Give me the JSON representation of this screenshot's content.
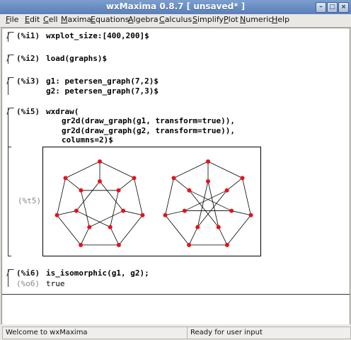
{
  "window": {
    "title": "wxMaxima 0.8.7 [ unsaved* ]"
  },
  "window_buttons": [
    {
      "name": "minimize-icon",
      "glyph": "–"
    },
    {
      "name": "maximize-icon",
      "glyph": "□"
    },
    {
      "name": "close-icon",
      "glyph": "×"
    }
  ],
  "menu": [
    "File",
    "Edit",
    "Cell",
    "Maxima",
    "Equations",
    "Algebra",
    "Calculus",
    "Simplify",
    "Plot",
    "Numeric",
    "Help"
  ],
  "cells": {
    "i1": {
      "label": "(%i1)",
      "code": "wxplot_size:[400,200]$"
    },
    "i2": {
      "label": "(%i2)",
      "code": "load(graphs)$"
    },
    "i3": {
      "label": "(%i3)",
      "line1": "g1: petersen_graph(7,2)$",
      "line2": "g2: petersen_graph(7,3)$"
    },
    "i5": {
      "label": "(%i5)",
      "line1": "wxdraw(",
      "line2": "gr2d(draw_graph(g1, transform=true)),",
      "line3": "gr2d(draw_graph(g2, transform=true)),",
      "line4": "columns=2)$"
    },
    "t5": {
      "label": "(%t5)"
    },
    "i6": {
      "label": "(%i6)",
      "code": "is_isomorphic(g1, g2);"
    },
    "o6": {
      "label": "(%o6)",
      "value": "true"
    }
  },
  "graphs": [
    {
      "name": "petersen-7-2",
      "n": 7,
      "k": 2
    },
    {
      "name": "petersen-7-3",
      "n": 7,
      "k": 3
    }
  ],
  "colors": {
    "vertex": "#e8101a",
    "edge": "#000000"
  },
  "status": {
    "left": "Welcome to wxMaxima",
    "right": "Ready for user input"
  }
}
